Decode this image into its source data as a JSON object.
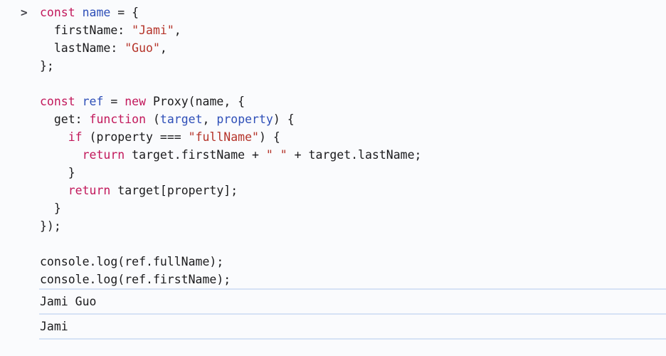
{
  "console": {
    "prompt_symbol": ">",
    "theme": {
      "background": "#fafbfd",
      "text": "#1b1b1d",
      "keyword": "#c2185b",
      "identifier": "#2e4fb8",
      "string": "#b5342a",
      "divider": "#d6e2f5",
      "prompt": "#46464d"
    },
    "input": {
      "language": "javascript",
      "lines": [
        {
          "indent": 0,
          "tokens": [
            {
              "t": "const",
              "c": "kw"
            },
            {
              "t": " ",
              "c": "pl"
            },
            {
              "t": "name",
              "c": "id"
            },
            {
              "t": " = {",
              "c": "pl"
            }
          ]
        },
        {
          "indent": 1,
          "tokens": [
            {
              "t": "firstName: ",
              "c": "pl"
            },
            {
              "t": "\"Jami\"",
              "c": "str"
            },
            {
              "t": ",",
              "c": "pl"
            }
          ]
        },
        {
          "indent": 1,
          "tokens": [
            {
              "t": "lastName: ",
              "c": "pl"
            },
            {
              "t": "\"Guo\"",
              "c": "str"
            },
            {
              "t": ",",
              "c": "pl"
            }
          ]
        },
        {
          "indent": 0,
          "tokens": [
            {
              "t": "};",
              "c": "pl"
            }
          ]
        },
        {
          "indent": 0,
          "tokens": [
            {
              "t": "",
              "c": "pl"
            }
          ]
        },
        {
          "indent": 0,
          "tokens": [
            {
              "t": "const",
              "c": "kw"
            },
            {
              "t": " ",
              "c": "pl"
            },
            {
              "t": "ref",
              "c": "id"
            },
            {
              "t": " = ",
              "c": "pl"
            },
            {
              "t": "new",
              "c": "kw"
            },
            {
              "t": " Proxy(name, {",
              "c": "pl"
            }
          ]
        },
        {
          "indent": 1,
          "tokens": [
            {
              "t": "get: ",
              "c": "pl"
            },
            {
              "t": "function",
              "c": "kw"
            },
            {
              "t": " (",
              "c": "pl"
            },
            {
              "t": "target",
              "c": "id"
            },
            {
              "t": ", ",
              "c": "pl"
            },
            {
              "t": "property",
              "c": "id"
            },
            {
              "t": ") {",
              "c": "pl"
            }
          ]
        },
        {
          "indent": 2,
          "tokens": [
            {
              "t": "if",
              "c": "kw"
            },
            {
              "t": " (property === ",
              "c": "pl"
            },
            {
              "t": "\"fullName\"",
              "c": "str"
            },
            {
              "t": ") {",
              "c": "pl"
            }
          ]
        },
        {
          "indent": 3,
          "tokens": [
            {
              "t": "return",
              "c": "kw"
            },
            {
              "t": " target.firstName + ",
              "c": "pl"
            },
            {
              "t": "\" \"",
              "c": "str"
            },
            {
              "t": " + target.lastName;",
              "c": "pl"
            }
          ]
        },
        {
          "indent": 2,
          "tokens": [
            {
              "t": "}",
              "c": "pl"
            }
          ]
        },
        {
          "indent": 2,
          "tokens": [
            {
              "t": "return",
              "c": "kw"
            },
            {
              "t": " target[property];",
              "c": "pl"
            }
          ]
        },
        {
          "indent": 1,
          "tokens": [
            {
              "t": "}",
              "c": "pl"
            }
          ]
        },
        {
          "indent": 0,
          "tokens": [
            {
              "t": "});",
              "c": "pl"
            }
          ]
        },
        {
          "indent": 0,
          "tokens": [
            {
              "t": "",
              "c": "pl"
            }
          ]
        },
        {
          "indent": 0,
          "tokens": [
            {
              "t": "console.log(ref.fullName);",
              "c": "pl"
            }
          ]
        },
        {
          "indent": 0,
          "tokens": [
            {
              "t": "console.log(ref.firstName);",
              "c": "pl"
            }
          ]
        }
      ]
    },
    "outputs": [
      {
        "text": "Jami Guo"
      },
      {
        "text": "Jami"
      }
    ]
  }
}
